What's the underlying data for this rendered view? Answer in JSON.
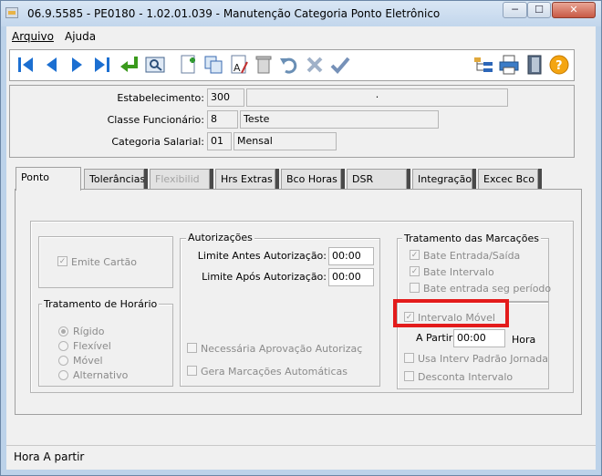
{
  "window": {
    "title": "06.9.5585 - PE0180 - 1.02.01.039 - Manutenção Categoria Ponto Eletrônico",
    "minimize": "─",
    "maximize": "☐",
    "close": "✕"
  },
  "menu": {
    "arquivo": "Arquivo",
    "ajuda": "Ajuda"
  },
  "toolbar": {
    "buttons": [
      "first-icon",
      "prev-icon",
      "next-icon",
      "last-icon",
      "goto-icon",
      "zoom-icon",
      "add-icon",
      "copy-icon",
      "edit-icon",
      "delete-icon",
      "undo-icon",
      "cancel-icon",
      "save-icon",
      "tree-icon",
      "print-icon",
      "exit-icon",
      "help-icon"
    ],
    "help_label": "?"
  },
  "header": {
    "estabelecimento": {
      "label": "Estabelecimento:",
      "code": "300",
      "desc": "·"
    },
    "classe": {
      "label": "Classe Funcionário:",
      "code": "8",
      "desc": "Teste"
    },
    "categoria": {
      "label": "Categoria Salarial:",
      "code": "01",
      "desc": "Mensal"
    }
  },
  "tabs": [
    "Ponto",
    "Tolerâncias",
    "Flexibilid",
    "Hrs Extras",
    "Bco Horas",
    "DSR",
    "Integração",
    "Excec Bco"
  ],
  "ponto": {
    "emite_cartao": "Emite Cartão",
    "tratamento_horario": {
      "title": "Tratamento de Horário",
      "options": [
        "Rígido",
        "Flexível",
        "Móvel",
        "Alternativo"
      ],
      "selected": "Rígido"
    },
    "autorizacoes": {
      "title": "Autorizações",
      "limite_antes_label": "Limite Antes Autorização:",
      "limite_antes_value": "00:00",
      "limite_apos_label": "Limite Após Autorização:",
      "limite_apos_value": "00:00",
      "necessaria": "Necessária Aprovação Autorizaç",
      "gera": "Gera Marcações Automáticas"
    },
    "tratamento_marcacoes": {
      "title": "Tratamento das Marcações",
      "bate_entrada_saida": "Bate Entrada/Saída",
      "bate_intervalo": "Bate Intervalo",
      "bate_entrada_seg": "Bate entrada seg período",
      "intervalo_movel": "Intervalo Móvel",
      "a_partir_label": "A Partir:",
      "a_partir_value": "00:00",
      "hora_label": "Hora",
      "usa_interv": "Usa Interv Padrão Jornada",
      "desconta": "Desconta Intervalo"
    }
  },
  "status": {
    "text": "Hora A partir"
  }
}
